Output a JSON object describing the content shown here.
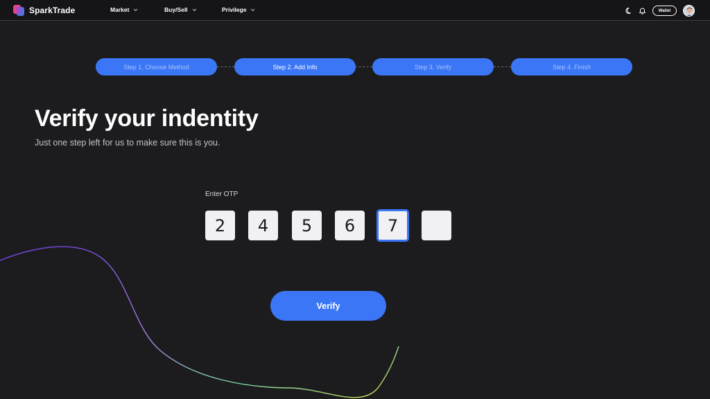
{
  "brand": {
    "name": "SparkTrade",
    "logo_icon": "sparktrade-logo-icon"
  },
  "nav": {
    "items": [
      {
        "label": "Market"
      },
      {
        "label": "Buy/Sell"
      },
      {
        "label": "Privilege"
      }
    ],
    "wallet_label": "Wallet",
    "icons": [
      "moon-icon",
      "bell-icon"
    ]
  },
  "steps": [
    {
      "label": "Step 1. Choose Method",
      "active": false
    },
    {
      "label": "Step 2. Add Info",
      "active": true
    },
    {
      "label": "Step 3. Verify",
      "active": false
    },
    {
      "label": "Step 4. Finish",
      "active": false
    }
  ],
  "heading": {
    "title": "Verify your indentity",
    "subtitle": "Just one step left for us to make sure this is you."
  },
  "otp": {
    "label": "Enter OTP",
    "digits": [
      "2",
      "4",
      "5",
      "6",
      "7",
      ""
    ],
    "focused_index": 4
  },
  "verify_label": "Verify",
  "colors": {
    "background": "#1c1c1f",
    "accent": "#3b76f6",
    "navbar": "#151518"
  }
}
